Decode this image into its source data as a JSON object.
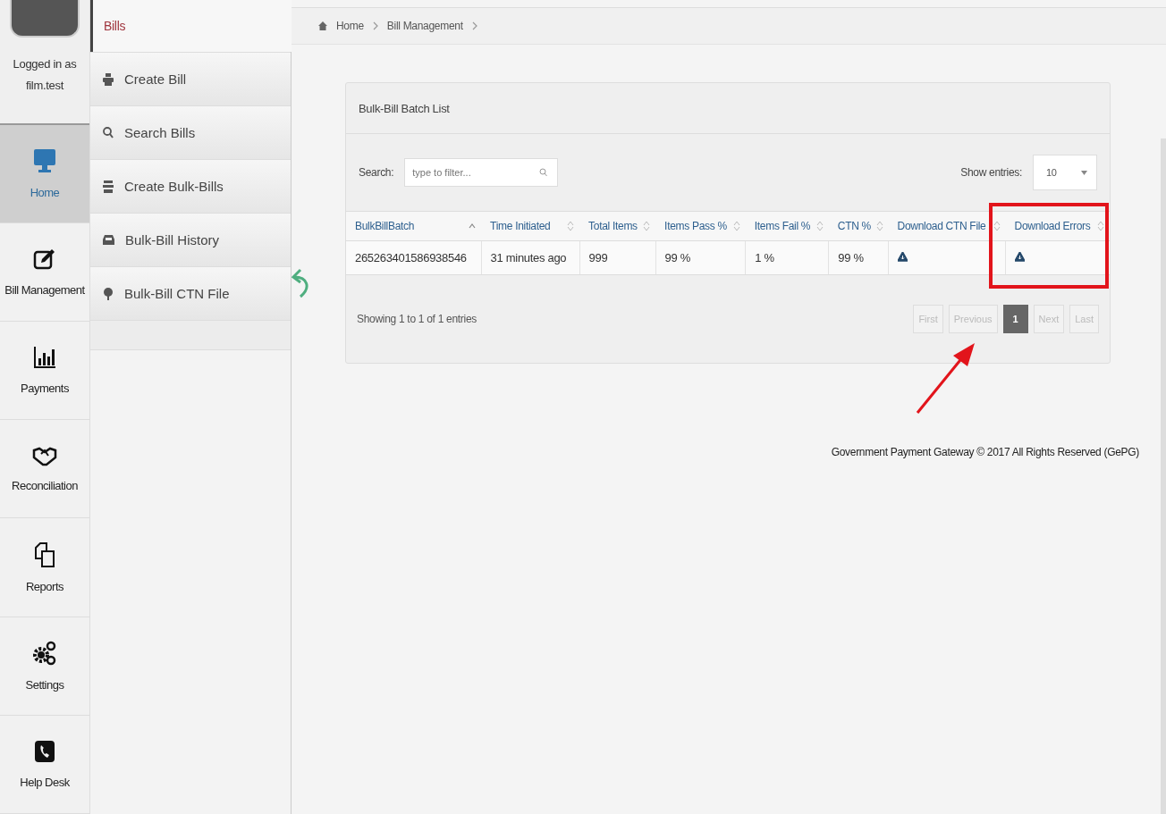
{
  "user": {
    "line1": "Logged in as",
    "line2": "film.test"
  },
  "rail": [
    {
      "label": "Home",
      "selected": true
    },
    {
      "label": "Bill Management",
      "selected": false
    },
    {
      "label": "Payments",
      "selected": false
    },
    {
      "label": "Reconciliation",
      "selected": false
    },
    {
      "label": "Reports",
      "selected": false
    },
    {
      "label": "Settings",
      "selected": false
    },
    {
      "label": "Help Desk",
      "selected": false
    }
  ],
  "submenu": {
    "title": "Bills",
    "items": [
      "Create Bill",
      "Search Bills",
      "Create Bulk-Bills",
      "Bulk-Bill History",
      "Bulk-Bill CTN File"
    ]
  },
  "breadcrumb": [
    "Home",
    "Bill Management"
  ],
  "panel": {
    "title": "Bulk-Bill Batch List",
    "search": {
      "label": "Search:",
      "placeholder": "type to filter..."
    },
    "entries": {
      "label": "Show entries:",
      "value": "10"
    },
    "table": {
      "columns": [
        {
          "label": "BulkBillBatch",
          "sorted": true
        },
        {
          "label": "Time Initiated",
          "sorted": false
        },
        {
          "label": "Total Items",
          "sorted": false
        },
        {
          "label": "Items Pass %",
          "sorted": false
        },
        {
          "label": "Items Fail %",
          "sorted": false
        },
        {
          "label": "CTN %",
          "sorted": false
        },
        {
          "label": "Download CTN File",
          "sorted": false
        },
        {
          "label": "Download Errors",
          "sorted": false
        }
      ],
      "rows": [
        [
          "265263401586938546",
          "31 minutes ago",
          "999",
          "99 %",
          "1 %",
          "99 %",
          {
            "kind": "download"
          },
          {
            "kind": "download"
          }
        ]
      ]
    },
    "info": "Showing 1 to 1 of 1 entries",
    "pages": [
      {
        "label": "First",
        "selected": false,
        "disabled": true
      },
      {
        "label": "Previous",
        "selected": false,
        "disabled": true
      },
      {
        "label": "1",
        "selected": true,
        "disabled": false
      },
      {
        "label": "Next",
        "selected": false,
        "disabled": true
      },
      {
        "label": "Last",
        "selected": false,
        "disabled": true
      }
    ]
  },
  "footer": "Government Payment Gateway © 2017 All Rights Reserved (GePG)"
}
